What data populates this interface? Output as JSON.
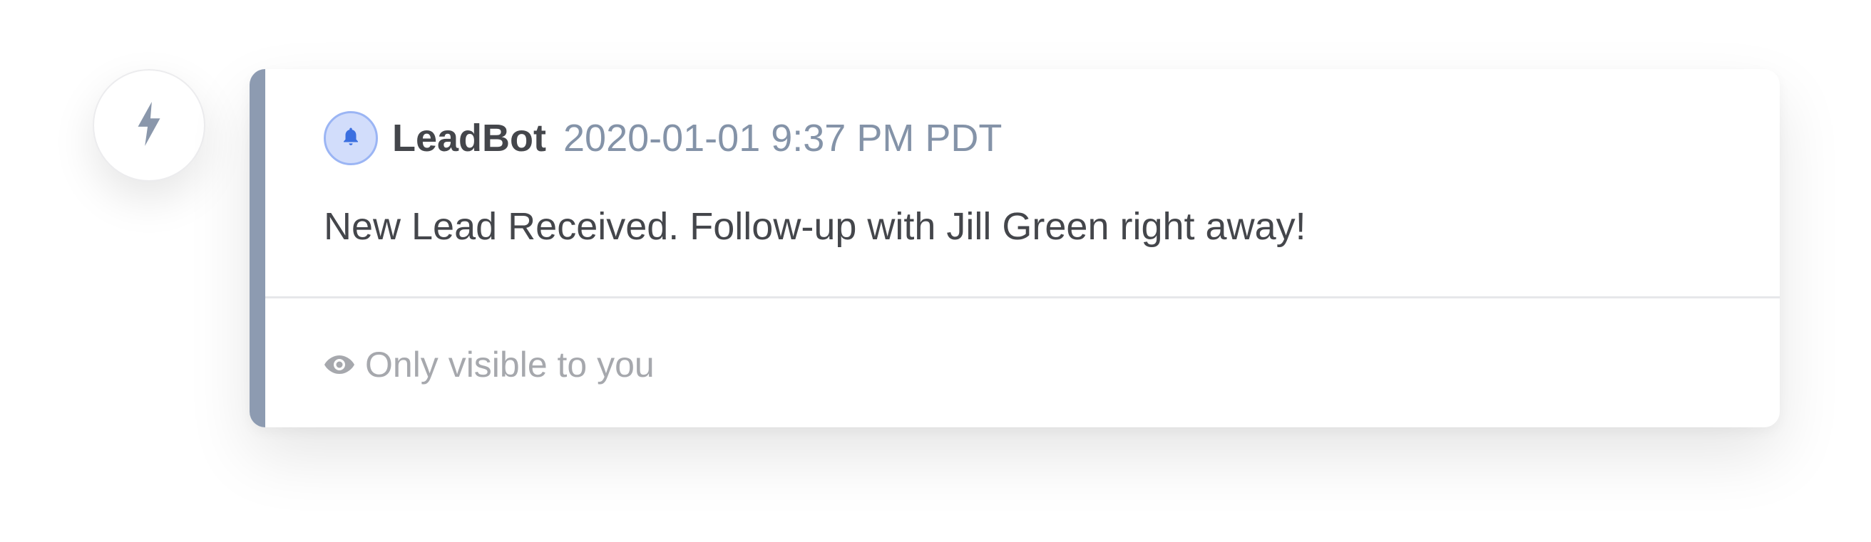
{
  "sidebar": {
    "icon": "lightning-bolt-icon"
  },
  "message": {
    "bot_icon": "bell-icon",
    "bot_name": "LeadBot",
    "timestamp": "2020-01-01 9:37 PM PDT",
    "text": "New Lead Received. Follow-up with Jill Green right away!",
    "visibility_icon": "eye-icon",
    "visibility_text": "Only visible to you"
  },
  "colors": {
    "accent_bar": "#8d9bb1",
    "bot_avatar_bg": "#d2ddfb",
    "bot_avatar_border": "#9bb5f4",
    "bell": "#3b6fe0",
    "timestamp": "#8493a8",
    "bolt": "#8a97ab"
  }
}
